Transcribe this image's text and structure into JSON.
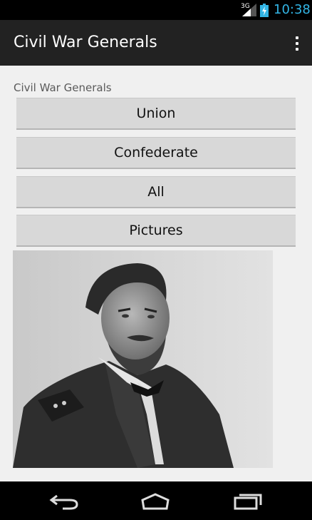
{
  "status_bar": {
    "network_type": "3G",
    "time": "10:38"
  },
  "action_bar": {
    "title": "Civil War Generals",
    "overflow_icon": "overflow-menu-icon"
  },
  "content": {
    "heading": "Civil War Generals",
    "buttons": [
      {
        "label": "Union"
      },
      {
        "label": "Confederate"
      },
      {
        "label": "All"
      },
      {
        "label": "Pictures"
      }
    ],
    "image_icon": "portrait-photo"
  },
  "nav_bar": {
    "back_icon": "back-icon",
    "home_icon": "home-icon",
    "recents_icon": "recents-icon"
  },
  "colors": {
    "accent": "#33b5e5",
    "action_bar": "#222222",
    "background": "#f0f0f0",
    "button": "#d8d8d8"
  }
}
